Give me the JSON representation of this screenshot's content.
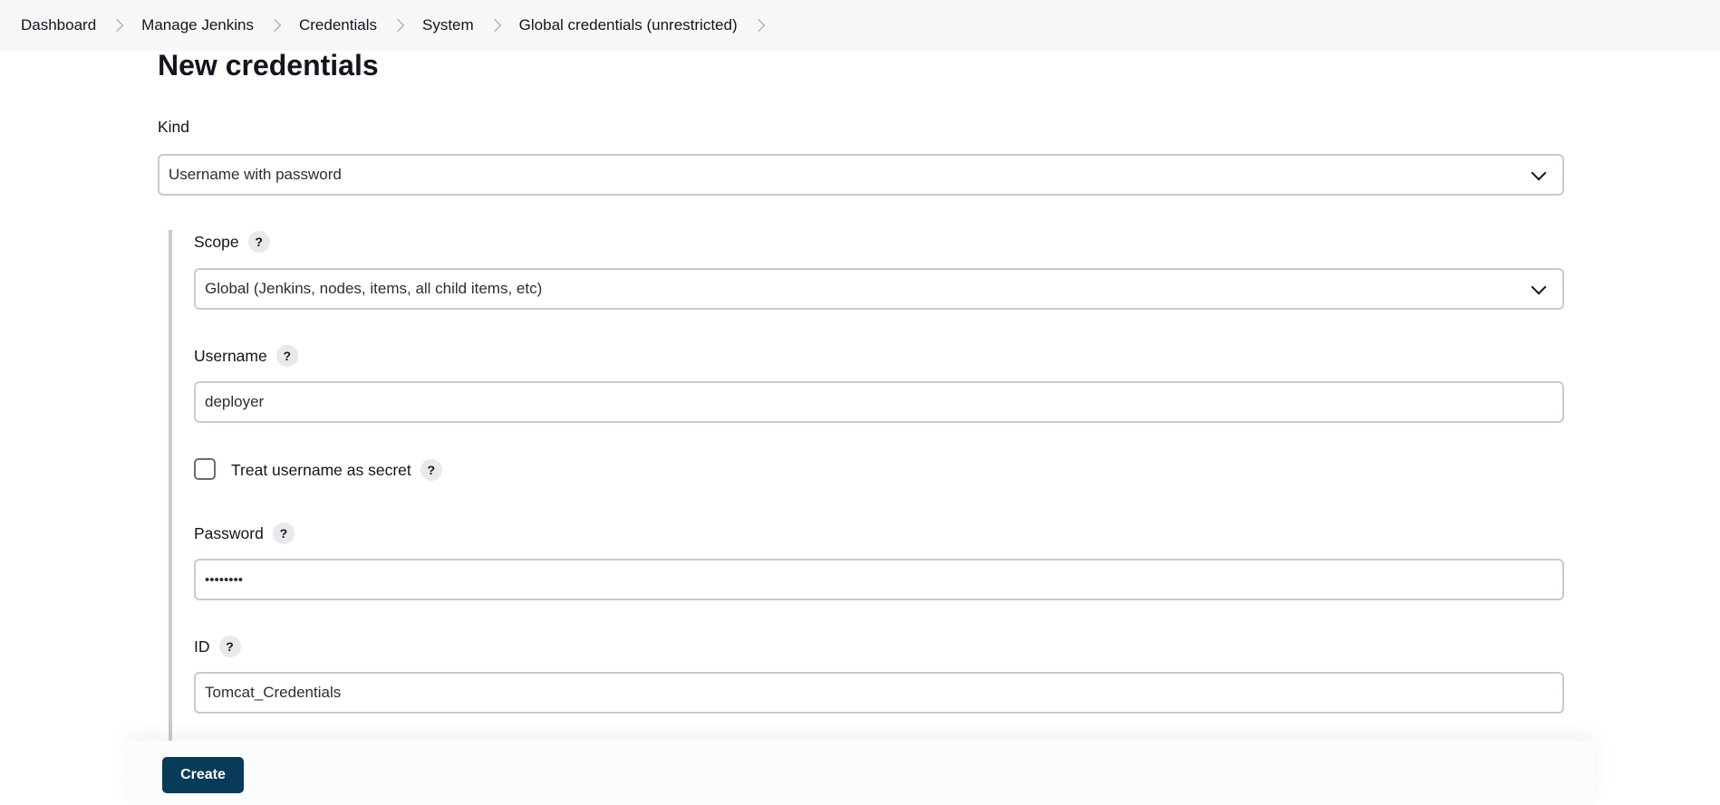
{
  "breadcrumb": {
    "items": [
      {
        "label": "Dashboard"
      },
      {
        "label": "Manage Jenkins"
      },
      {
        "label": "Credentials"
      },
      {
        "label": "System"
      },
      {
        "label": "Global credentials (unrestricted)"
      }
    ]
  },
  "page": {
    "title": "New credentials"
  },
  "form": {
    "kind": {
      "label": "Kind",
      "value": "Username with password"
    },
    "scope": {
      "label": "Scope",
      "value": "Global (Jenkins, nodes, items, all child items, etc)",
      "help": "?"
    },
    "username": {
      "label": "Username",
      "value": "deployer",
      "help": "?"
    },
    "treat_secret": {
      "label": "Treat username as secret",
      "checked": false,
      "help": "?"
    },
    "password": {
      "label": "Password",
      "value": "••••••••",
      "help": "?"
    },
    "id": {
      "label": "ID",
      "value": "Tomcat_Credentials",
      "help": "?"
    }
  },
  "actions": {
    "create_label": "Create"
  },
  "colors": {
    "primary_button": "#083a5a",
    "breadcrumb_bg": "#f7f7f8"
  }
}
